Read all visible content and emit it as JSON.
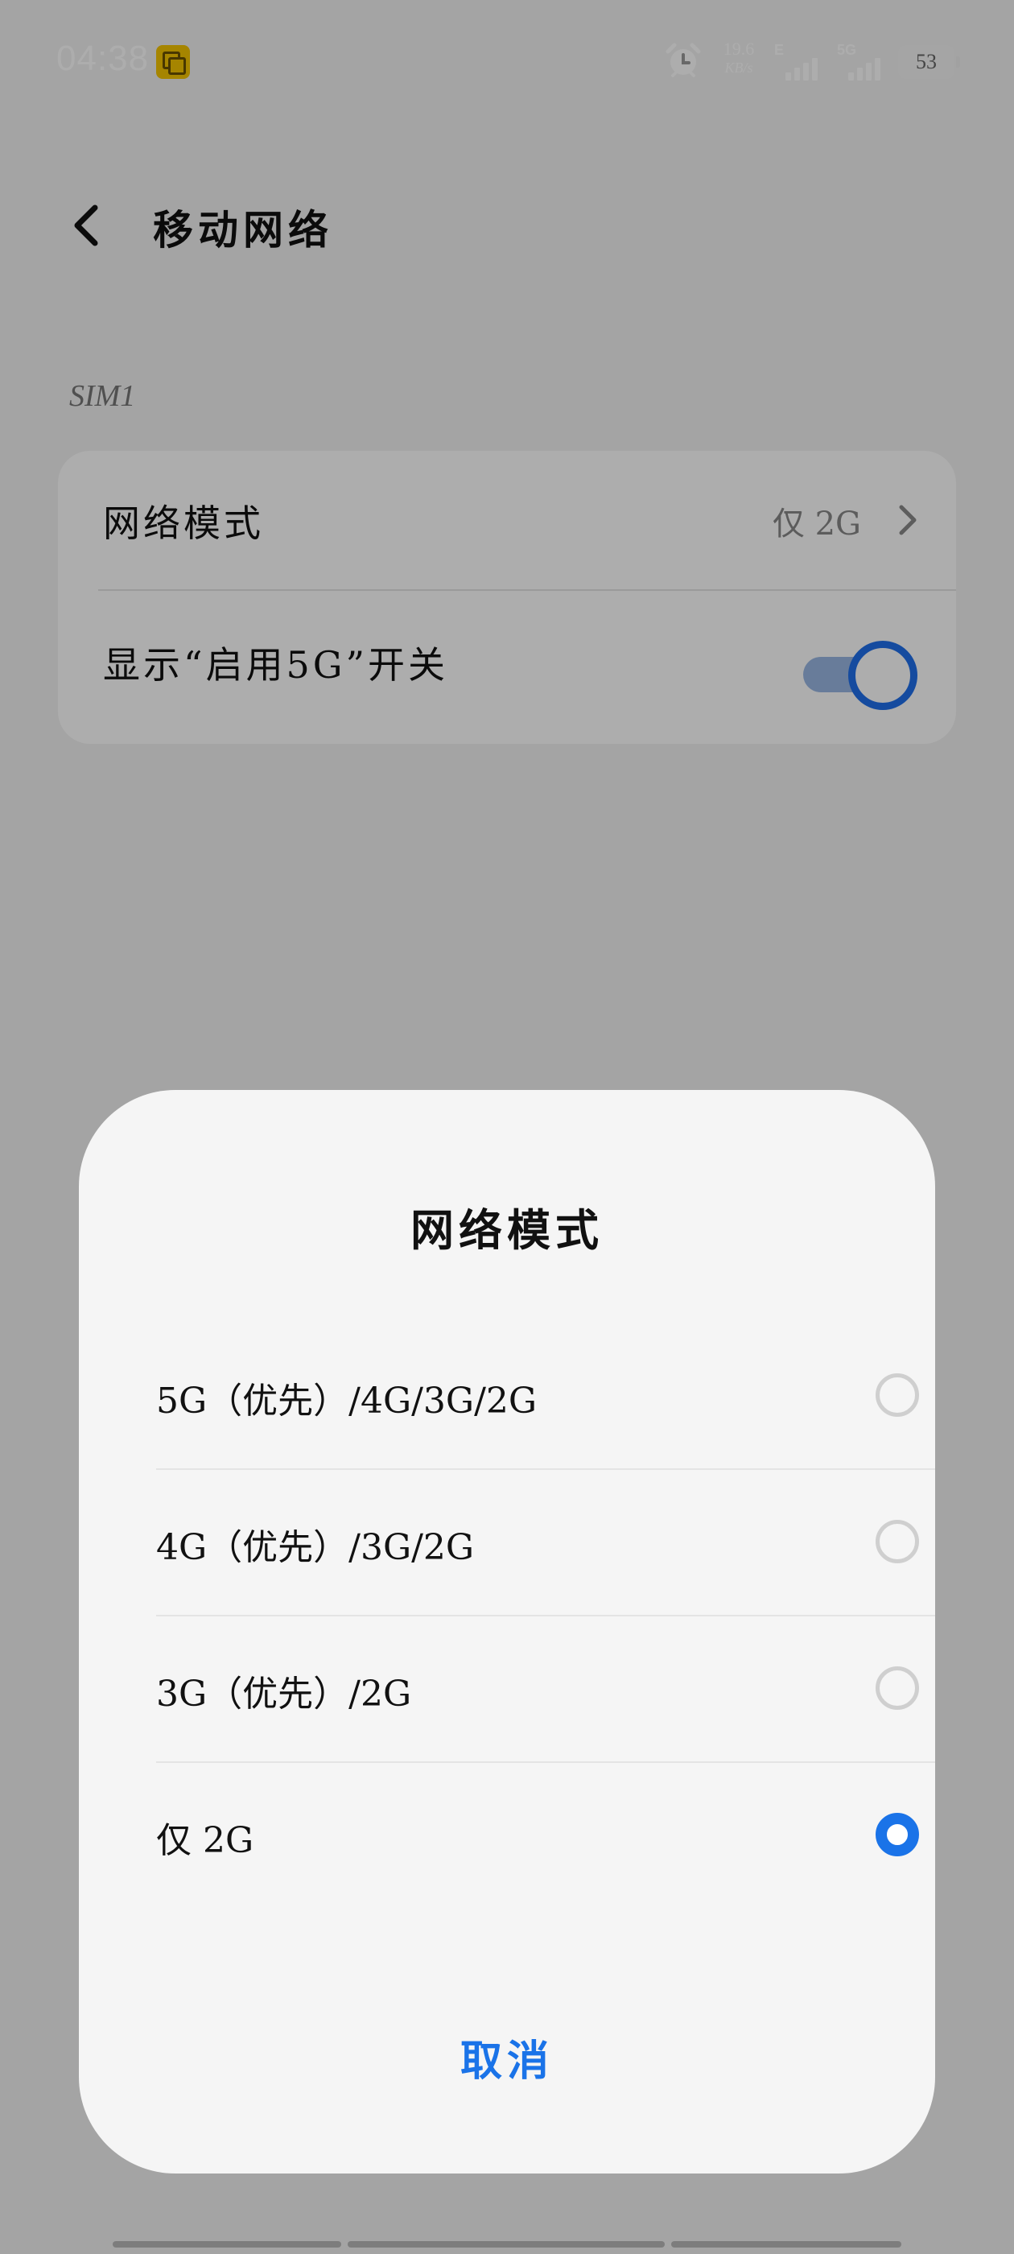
{
  "status_bar": {
    "time": "04:38",
    "app_icon": "copy-app-icon",
    "alarm_icon": "alarm-clock-icon",
    "net_speed_value": "19.6",
    "net_speed_unit": "KB/s",
    "sim1_type": "E",
    "sim2_type": "5G",
    "battery": "53"
  },
  "header": {
    "title": "移动网络",
    "back_icon": "back-arrow-icon"
  },
  "sim_section": {
    "label": "SIM1",
    "network_mode_label": "网络模式",
    "network_mode_value": "仅 2G",
    "show_5g_switch_label": "显示“启用5G”开关",
    "show_5g_switch_on": true
  },
  "dialog": {
    "title": "网络模式",
    "options": [
      {
        "label": "5G（优先）/4G/3G/2G",
        "selected": false
      },
      {
        "label": "4G（优先）/3G/2G",
        "selected": false
      },
      {
        "label": "3G（优先）/2G",
        "selected": false
      },
      {
        "label": "仅 2G",
        "selected": true
      }
    ],
    "cancel_label": "取消"
  },
  "colors": {
    "accent": "#1a73e8",
    "toggle_track": "#9ab7e3",
    "scrim": "rgba(0,0,0,0.32)"
  }
}
